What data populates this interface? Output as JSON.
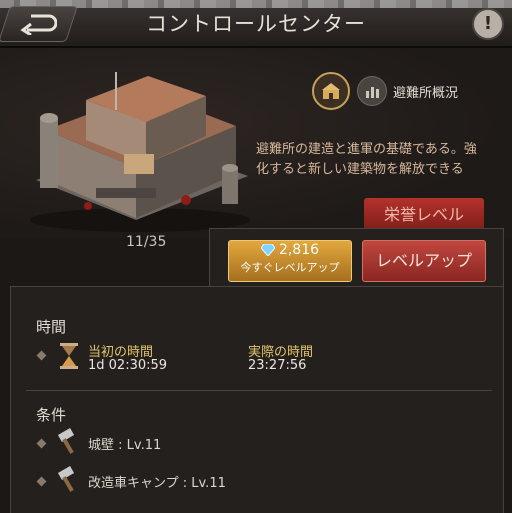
{
  "header": {
    "title": "コントロールセンター",
    "back_icon": "back-arrow-icon",
    "info_icon": "exclamation-icon",
    "info_label": "!"
  },
  "building": {
    "level_progress": "11/35",
    "icon": "shelter-building"
  },
  "category": {
    "active_icon": "shelter-icon",
    "inactive_icon": "chart-icon",
    "label": "避難所概況"
  },
  "description": {
    "line1": "避難所の建造と進軍の基礎である。強",
    "line2": "化すると新しい建築物を解放できる"
  },
  "buttons": {
    "honor_label": "栄誉レベル",
    "instant_cost": "2,816",
    "instant_label": "今すぐレベルアップ",
    "levelup_label": "レベルアップ"
  },
  "time_section": {
    "title": "時間",
    "original_label": "当初の時間",
    "original_value": "1d 02:30:59",
    "actual_label": "実際の時間",
    "actual_value": "23:27:56"
  },
  "conditions": {
    "title": "条件",
    "items": [
      {
        "label": "城壁 : Lv.11"
      },
      {
        "label": "改造車キャンプ : Lv.11"
      }
    ]
  },
  "colors": {
    "gold": "#e2c46a",
    "levelup_red": "#c0473f",
    "instant_orange": "#e2a83e"
  }
}
